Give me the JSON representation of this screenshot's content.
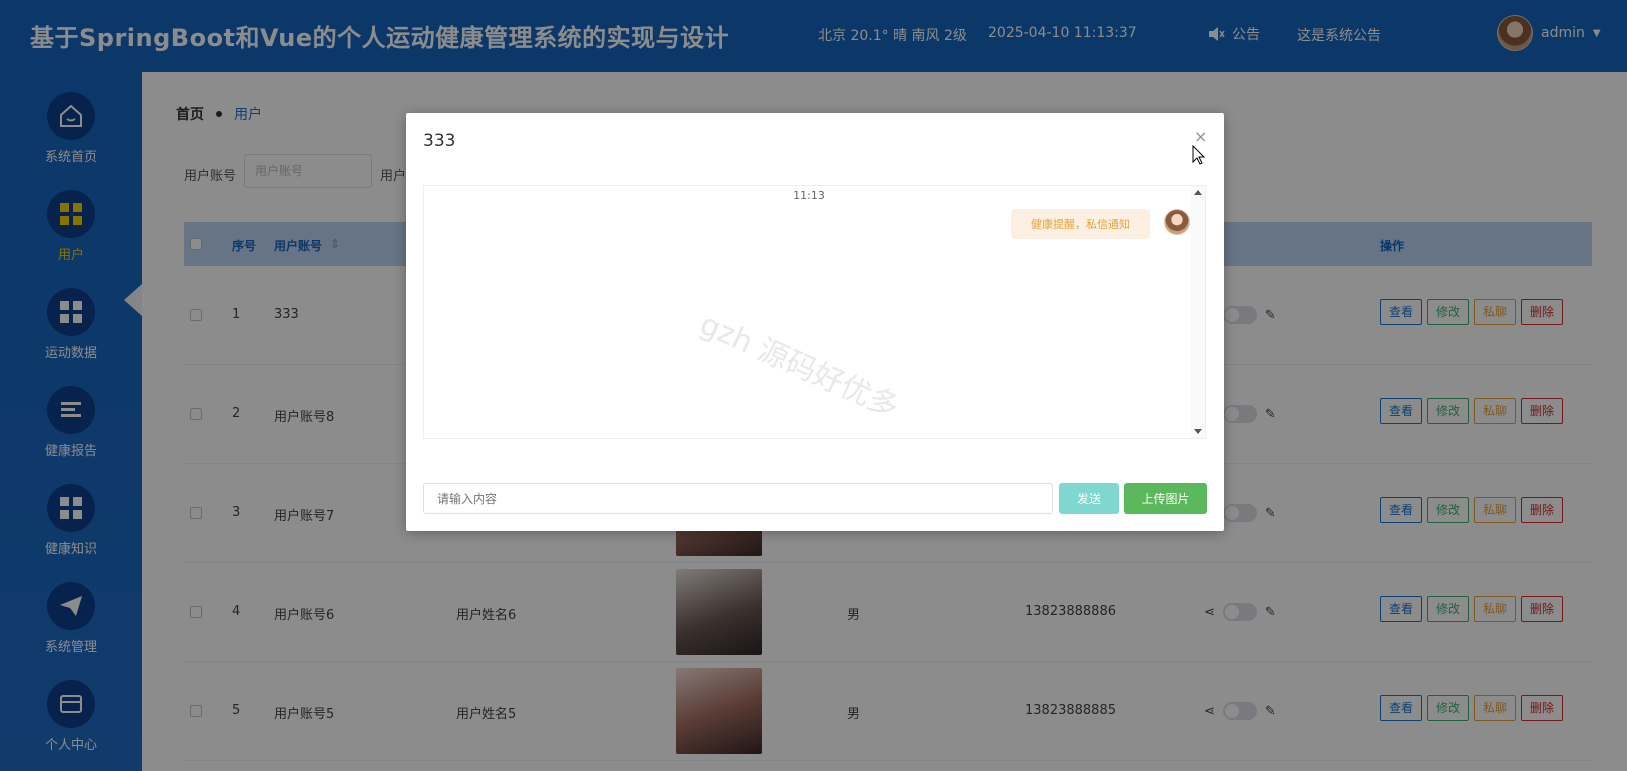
{
  "header": {
    "title": "基于SpringBoot和Vue的个人运动健康管理系统的实现与设计",
    "weather": "北京 20.1° 晴 南风 2级",
    "datetime": "2025-04-10 11:13:37",
    "notice_label": "公告",
    "notice_text": "这是系统公告",
    "username": "admin",
    "bg_color": "#1565c0"
  },
  "sidebar": {
    "items": [
      {
        "label": "系统首页",
        "icon": "home-icon"
      },
      {
        "label": "用户",
        "icon": "grid-icon"
      },
      {
        "label": "运动数据",
        "icon": "grid-icon"
      },
      {
        "label": "健康报告",
        "icon": "list-icon"
      },
      {
        "label": "健康知识",
        "icon": "grid-icon"
      },
      {
        "label": "系统管理",
        "icon": "send-icon"
      },
      {
        "label": "个人中心",
        "icon": "wallet-icon"
      }
    ]
  },
  "breadcrumb": {
    "home": "首页",
    "current": "用户"
  },
  "search": {
    "label1": "用户账号",
    "placeholder1": "用户账号",
    "label2_partial": "用户"
  },
  "table": {
    "headers": {
      "index": "序号",
      "account": "用户账号",
      "actions": "操作"
    },
    "rows": [
      {
        "index": "1",
        "account": "333",
        "name": "",
        "gender": "",
        "phone": ""
      },
      {
        "index": "2",
        "account": "用户账号8",
        "name": "",
        "gender": "",
        "phone": ""
      },
      {
        "index": "3",
        "account": "用户账号7",
        "name": "",
        "gender": "",
        "phone": ""
      },
      {
        "index": "4",
        "account": "用户账号6",
        "name": "用户姓名6",
        "gender": "男",
        "phone": "13823888886"
      },
      {
        "index": "5",
        "account": "用户账号5",
        "name": "用户姓名5",
        "gender": "男",
        "phone": "13823888885"
      }
    ],
    "ops": {
      "view": "查看",
      "edit": "修改",
      "msg": "私聊",
      "del": "删除"
    }
  },
  "dialog": {
    "title": "333",
    "close": "×",
    "chat_time": "11:13",
    "message": "健康提醒，私信通知",
    "input_placeholder": "请输入内容",
    "send_label": "发送",
    "upload_label": "上传图片",
    "watermark": "gzh 源码好优多"
  }
}
